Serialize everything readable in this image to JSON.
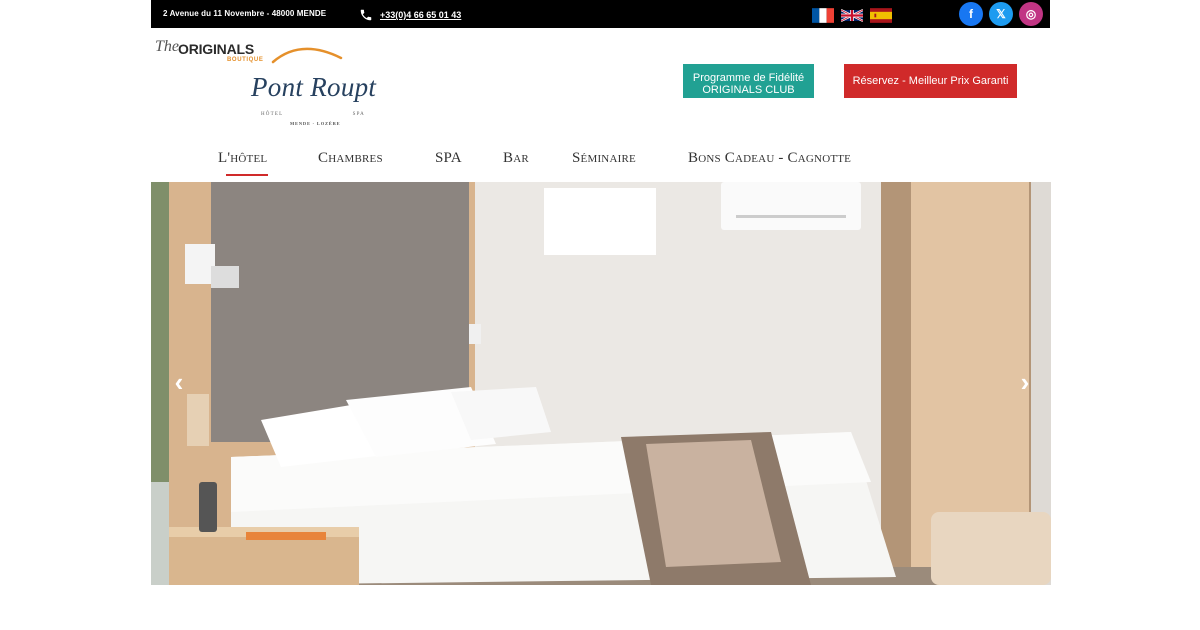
{
  "topbar": {
    "address": "2 Avenue du 11 Novembre - 48000 MENDE",
    "phone": "+33(0)4 66 65 01 43",
    "phone_icon": "phone-icon",
    "languages": [
      "fr",
      "en",
      "es"
    ],
    "socials": [
      {
        "name": "facebook",
        "glyph": "f",
        "color": "#1877f2"
      },
      {
        "name": "x",
        "glyph": "𝕏",
        "color": "#1d9bf0"
      },
      {
        "name": "instagram",
        "glyph": "◎",
        "color": "#c13584"
      }
    ]
  },
  "header": {
    "brand_the": "The",
    "brand_originals": "ORIGINALS",
    "brand_boutique": "BOUTIQUE",
    "hotel_name": "Pont Roupt",
    "hotel_left": "HÔTEL",
    "hotel_right": "SPA",
    "hotel_location": "MENDE - LOZÈRE",
    "club_button_line1": "Programme de Fidélité",
    "club_button_line2": "ORIGINALS CLUB",
    "book_button": "Réservez - Meilleur Prix Garanti"
  },
  "nav": {
    "items": [
      {
        "label": "L'hôtel",
        "active": true
      },
      {
        "label": "Chambres",
        "active": false
      },
      {
        "label": "SPA",
        "active": false
      },
      {
        "label": "Bar",
        "active": false
      },
      {
        "label": "Séminaire",
        "active": false
      },
      {
        "label": "Bons Cadeau - Cagnotte",
        "active": false
      }
    ]
  },
  "slider": {
    "prev_glyph": "‹",
    "next_glyph": "›",
    "loader_dot": "."
  },
  "colors": {
    "topbar": "#000000",
    "club_button": "#21a193",
    "book_button": "#d02a2a",
    "active_underline": "#d02a2a"
  }
}
